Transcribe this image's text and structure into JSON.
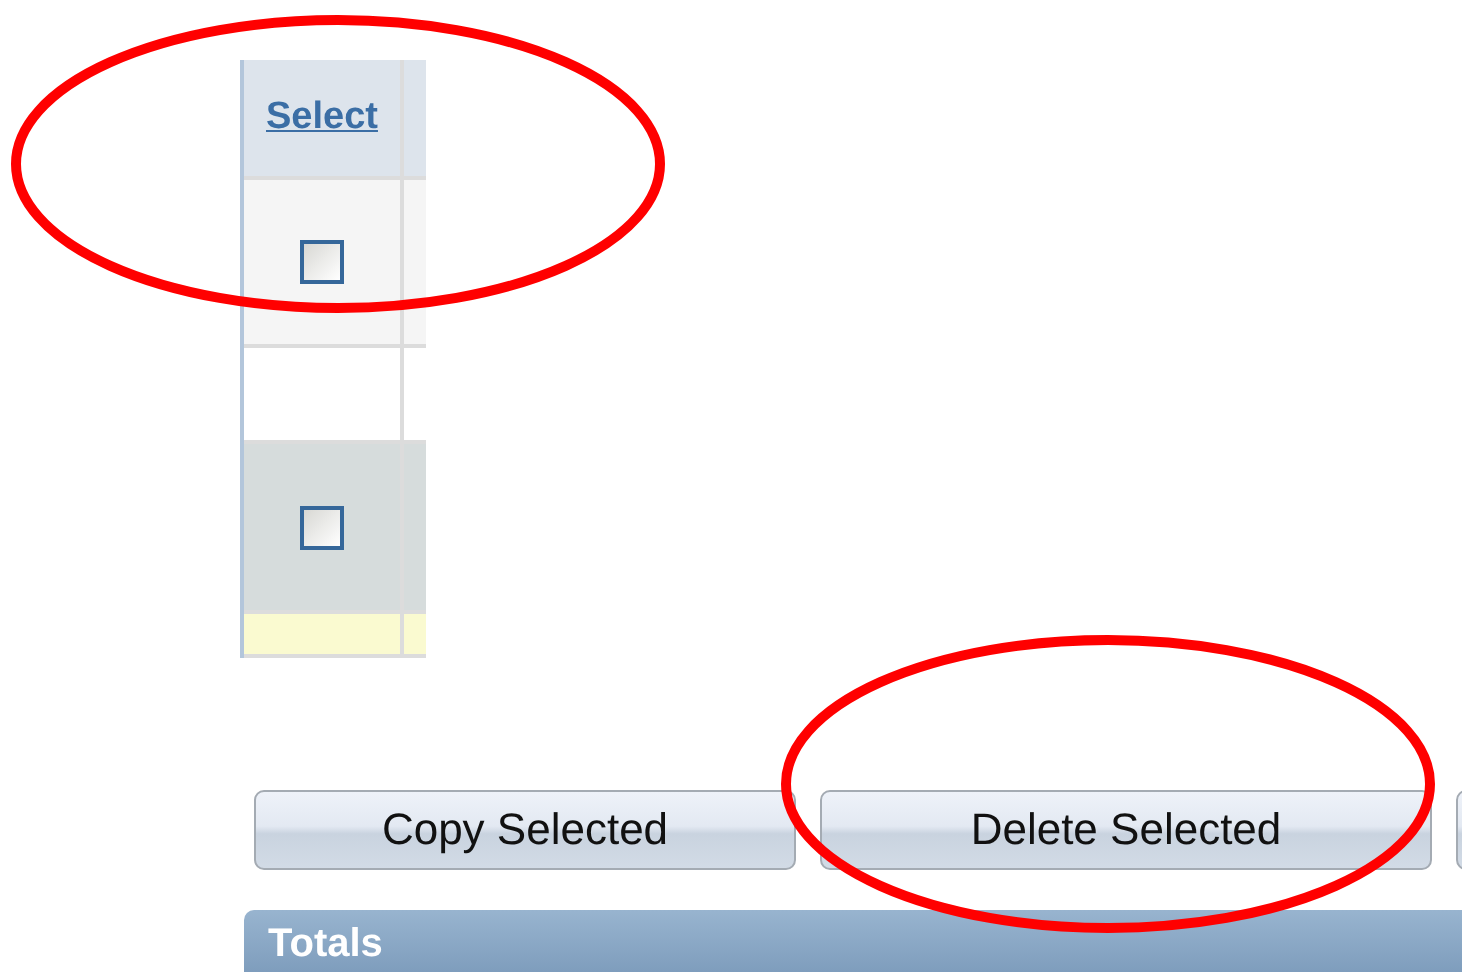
{
  "table": {
    "columns": [
      {
        "label": "Select"
      }
    ],
    "rows": [
      {
        "kind": "light",
        "checked": false
      },
      {
        "kind": "blank"
      },
      {
        "kind": "dark",
        "checked": false
      },
      {
        "kind": "yellow"
      }
    ]
  },
  "buttons": [
    {
      "label": "Copy Selected"
    },
    {
      "label": "Delete Selected"
    }
  ],
  "totals": {
    "title": "Totals"
  },
  "annotations": [
    {
      "kind": "ellipse",
      "color": "#ff0000"
    },
    {
      "kind": "ellipse",
      "color": "#ff0000"
    }
  ]
}
